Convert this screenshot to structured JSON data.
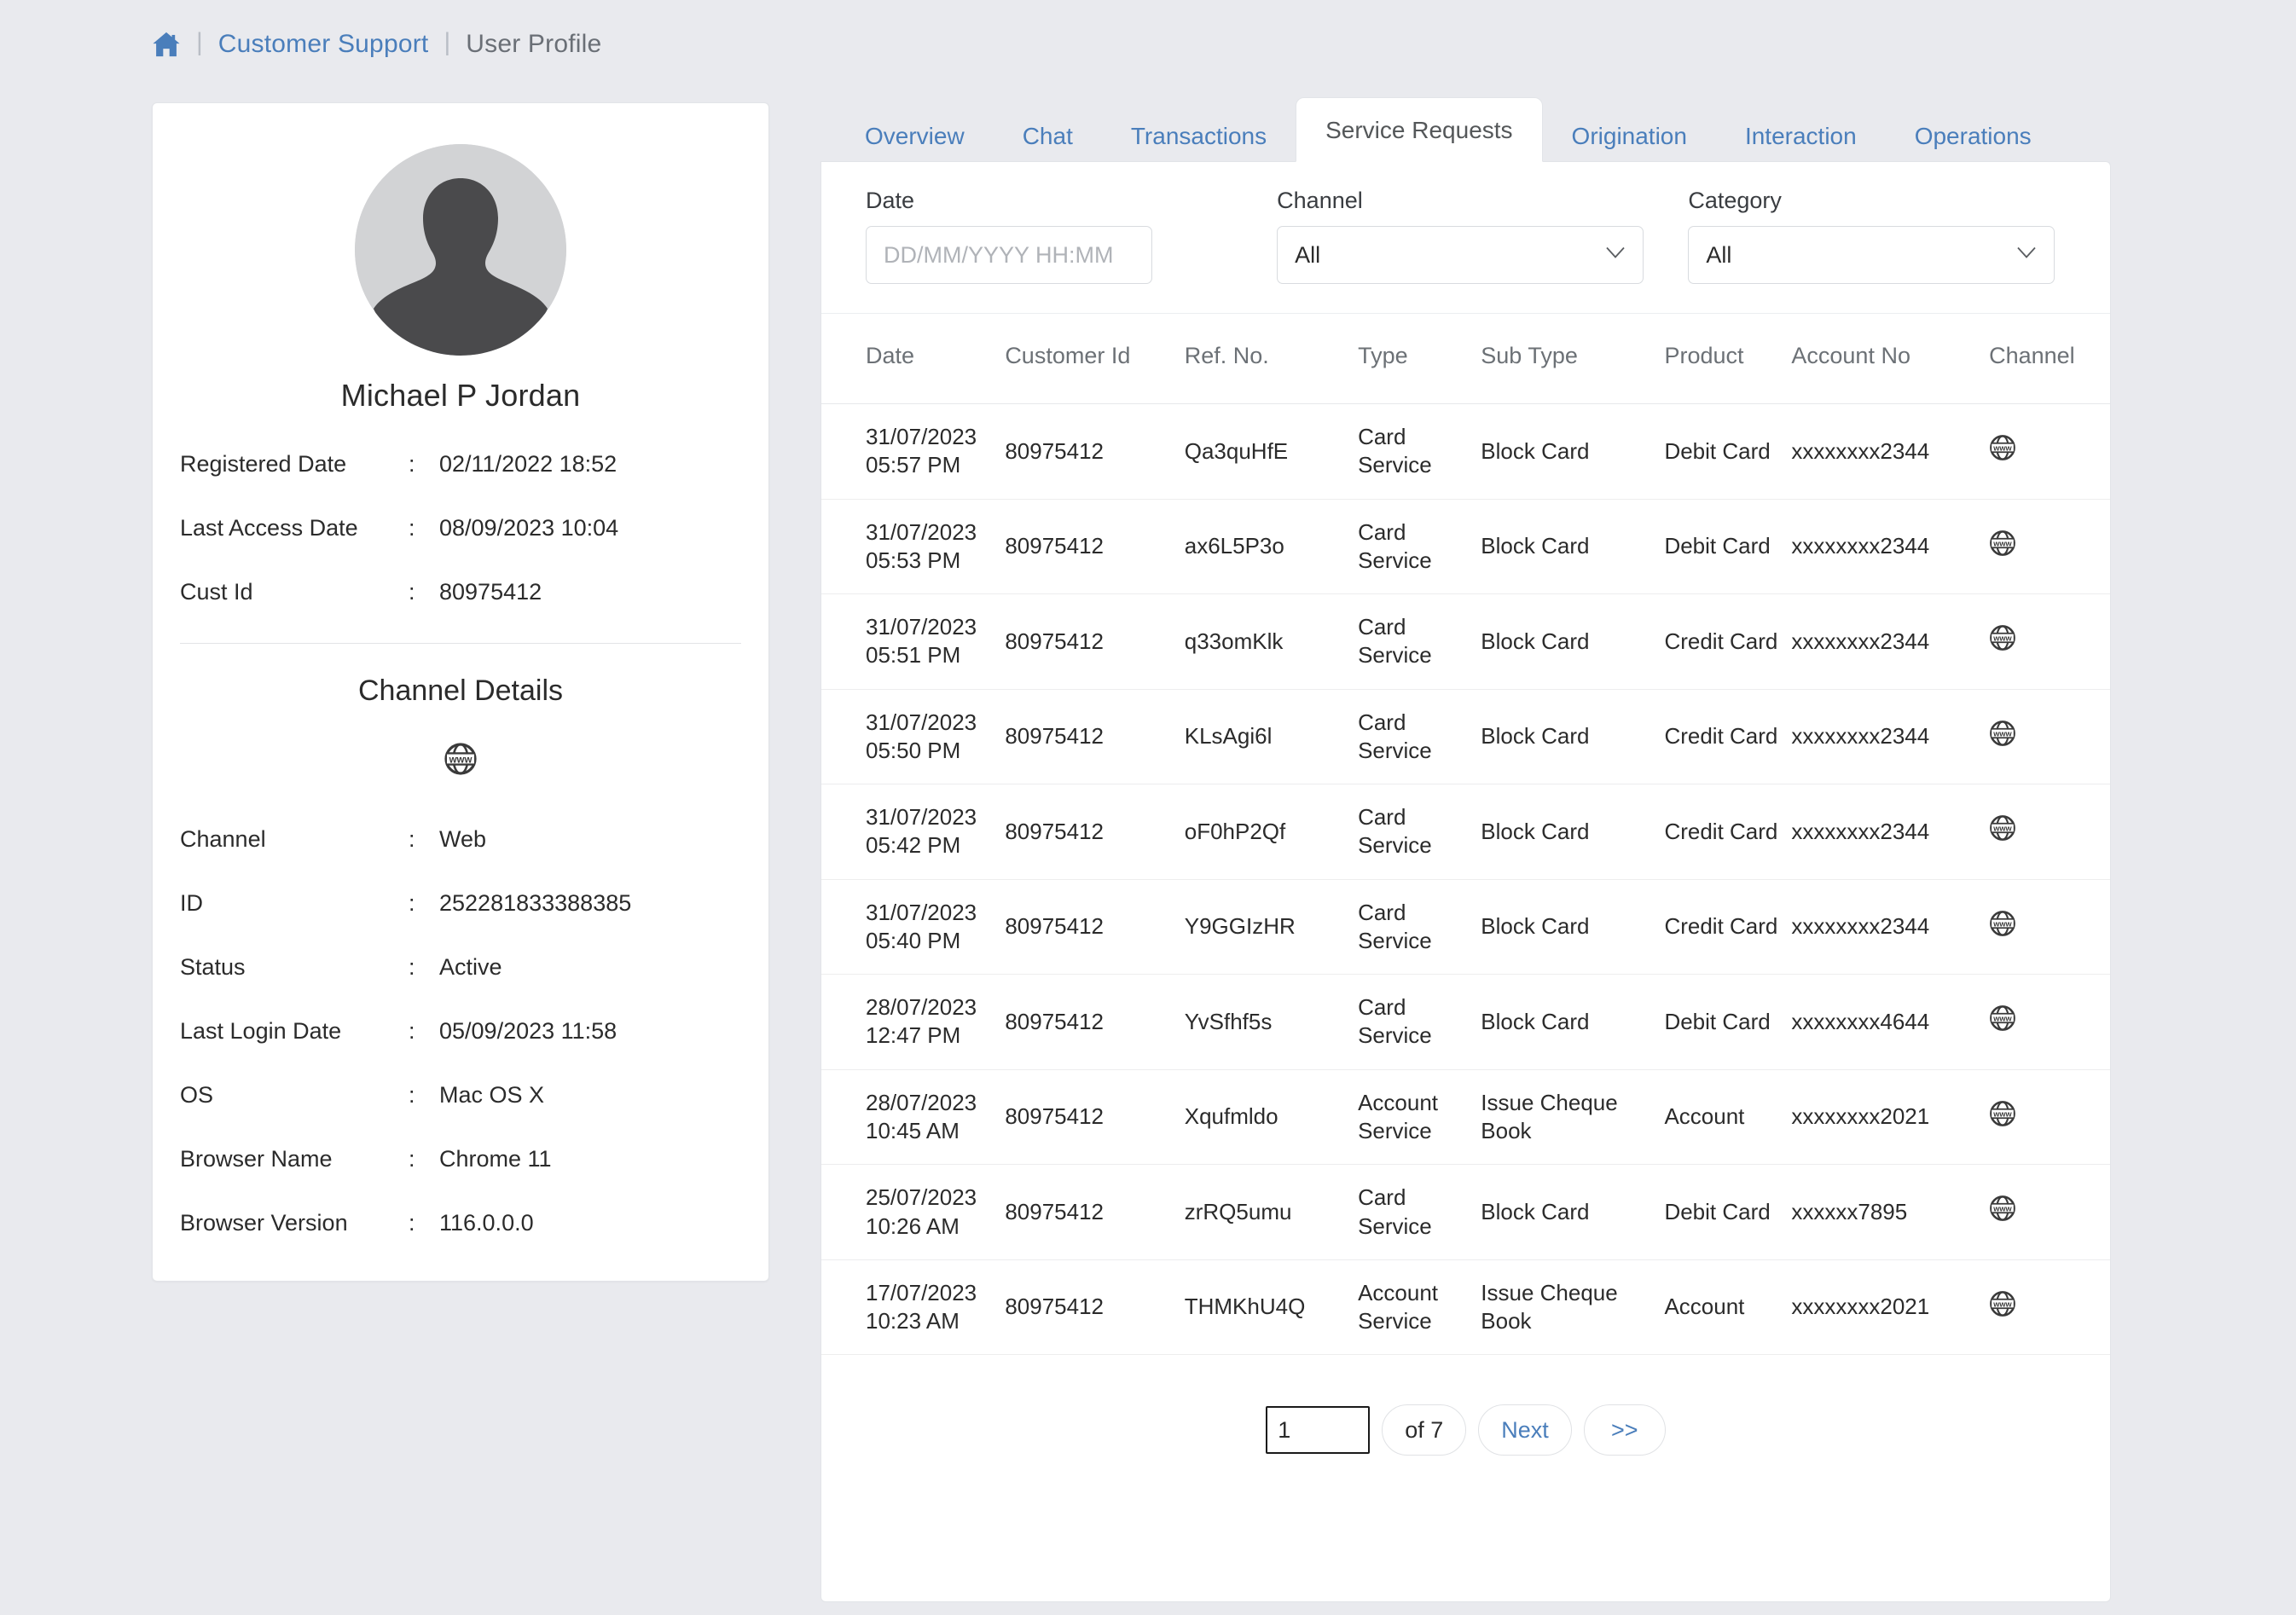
{
  "breadcrumb": {
    "home_icon": "home-icon",
    "separator": "|",
    "link": "Customer Support",
    "current": "User Profile"
  },
  "profile": {
    "avatar_icon": "user-avatar-placeholder",
    "name": "Michael P Jordan",
    "fields": [
      {
        "key": "Registered Date",
        "colon": ":",
        "value": "02/11/2022 18:52"
      },
      {
        "key": "Last Access Date",
        "colon": ":",
        "value": "08/09/2023 10:04"
      },
      {
        "key": "Cust Id",
        "colon": ":",
        "value": "80975412"
      }
    ],
    "channel_details": {
      "title": "Channel Details",
      "icon": "globe-www-icon",
      "fields": [
        {
          "key": "Channel",
          "colon": ":",
          "value": "Web"
        },
        {
          "key": "ID",
          "colon": ":",
          "value": "252281833388385"
        },
        {
          "key": "Status",
          "colon": ":",
          "value": "Active"
        },
        {
          "key": "Last Login Date",
          "colon": ":",
          "value": "05/09/2023 11:58"
        },
        {
          "key": "OS",
          "colon": ":",
          "value": "Mac OS X"
        },
        {
          "key": "Browser Name",
          "colon": ":",
          "value": "Chrome 11"
        },
        {
          "key": "Browser Version",
          "colon": ":",
          "value": "116.0.0.0"
        }
      ]
    }
  },
  "tabs": [
    {
      "label": "Overview",
      "active": false
    },
    {
      "label": "Chat",
      "active": false
    },
    {
      "label": "Transactions",
      "active": false
    },
    {
      "label": "Service Requests",
      "active": true
    },
    {
      "label": "Origination",
      "active": false
    },
    {
      "label": "Interaction",
      "active": false
    },
    {
      "label": "Operations",
      "active": false
    }
  ],
  "filters": {
    "date": {
      "label": "Date",
      "value": "",
      "placeholder": "DD/MM/YYYY HH:MM"
    },
    "channel": {
      "label": "Channel",
      "value": "All",
      "options": [
        "All"
      ]
    },
    "category": {
      "label": "Category",
      "value": "All",
      "options": [
        "All"
      ]
    }
  },
  "table": {
    "columns": [
      "Date",
      "Customer Id",
      "Ref. No.",
      "Type",
      "Sub Type",
      "Product",
      "Account No",
      "Channel"
    ],
    "rows": [
      {
        "date": "31/07/2023",
        "time": "05:57 PM",
        "customer_id": "80975412",
        "ref_no": "Qa3quHfE",
        "type": "Card Service",
        "sub_type": "Block Card",
        "product": "Debit Card",
        "account_no": "xxxxxxxx2344",
        "channel_icon": "globe-www-icon"
      },
      {
        "date": "31/07/2023",
        "time": "05:53 PM",
        "customer_id": "80975412",
        "ref_no": "ax6L5P3o",
        "type": "Card Service",
        "sub_type": "Block Card",
        "product": "Debit Card",
        "account_no": "xxxxxxxx2344",
        "channel_icon": "globe-www-icon"
      },
      {
        "date": "31/07/2023",
        "time": "05:51 PM",
        "customer_id": "80975412",
        "ref_no": "q33omKlk",
        "type": "Card Service",
        "sub_type": "Block Card",
        "product": "Credit Card",
        "account_no": "xxxxxxxx2344",
        "channel_icon": "globe-www-icon"
      },
      {
        "date": "31/07/2023",
        "time": "05:50 PM",
        "customer_id": "80975412",
        "ref_no": "KLsAgi6l",
        "type": "Card Service",
        "sub_type": "Block Card",
        "product": "Credit Card",
        "account_no": "xxxxxxxx2344",
        "channel_icon": "globe-www-icon"
      },
      {
        "date": "31/07/2023",
        "time": "05:42 PM",
        "customer_id": "80975412",
        "ref_no": "oF0hP2Qf",
        "type": "Card Service",
        "sub_type": "Block Card",
        "product": "Credit Card",
        "account_no": "xxxxxxxx2344",
        "channel_icon": "globe-www-icon"
      },
      {
        "date": "31/07/2023",
        "time": "05:40 PM",
        "customer_id": "80975412",
        "ref_no": "Y9GGIzHR",
        "type": "Card Service",
        "sub_type": "Block Card",
        "product": "Credit Card",
        "account_no": "xxxxxxxx2344",
        "channel_icon": "globe-www-icon"
      },
      {
        "date": "28/07/2023",
        "time": "12:47 PM",
        "customer_id": "80975412",
        "ref_no": "YvSfhf5s",
        "type": "Card Service",
        "sub_type": "Block Card",
        "product": "Debit Card",
        "account_no": "xxxxxxxx4644",
        "channel_icon": "globe-www-icon"
      },
      {
        "date": "28/07/2023",
        "time": "10:45 AM",
        "customer_id": "80975412",
        "ref_no": "Xqufmldo",
        "type": "Account Service",
        "sub_type": "Issue Cheque Book",
        "product": "Account",
        "account_no": "xxxxxxxx2021",
        "channel_icon": "globe-www-icon"
      },
      {
        "date": "25/07/2023",
        "time": "10:26 AM",
        "customer_id": "80975412",
        "ref_no": "zrRQ5umu",
        "type": "Card Service",
        "sub_type": "Block Card",
        "product": "Debit Card",
        "account_no": "xxxxxx7895",
        "channel_icon": "globe-www-icon"
      },
      {
        "date": "17/07/2023",
        "time": "10:23 AM",
        "customer_id": "80975412",
        "ref_no": "THMKhU4Q",
        "type": "Account Service",
        "sub_type": "Issue Cheque Book",
        "product": "Account",
        "account_no": "xxxxxxxx2021",
        "channel_icon": "globe-www-icon"
      }
    ]
  },
  "pagination": {
    "current_page": "1",
    "of_label": "of 7",
    "next_label": "Next",
    "last_label": ">>"
  },
  "colors": {
    "page_bg": "#e9eaee",
    "card_bg": "#ffffff",
    "link": "#4a7ebb",
    "text": "#2b2b2b",
    "muted": "#6c7176",
    "border": "#e2e4e8"
  }
}
